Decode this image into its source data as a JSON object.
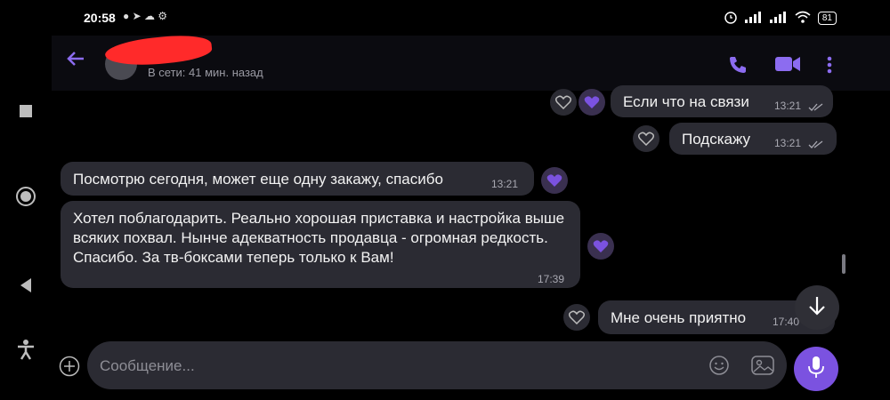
{
  "status": {
    "time": "20:58",
    "battery": "81"
  },
  "header": {
    "contact_name": "",
    "last_seen": "В сети: 41 мин. назад"
  },
  "messages": [
    {
      "text": "Если что на связи",
      "time": "13:21"
    },
    {
      "text": "Подскажу",
      "time": "13:21"
    },
    {
      "text": "Посмотрю сегодня, может еще одну закажу, спасибо",
      "time": "13:21"
    },
    {
      "text": "Хотел поблагодарить. Реально хорошая приставка и настройка выше всяких похвал. Нынче адекватность продавца - огромная редкость. Спасибо. За тв-боксами теперь только к Вам!",
      "time": "17:39"
    },
    {
      "text": "Мне очень приятно",
      "time": "17:40"
    }
  ],
  "composer": {
    "placeholder": "Сообщение..."
  },
  "colors": {
    "accent": "#7b52e0",
    "bubble": "#2b2b33",
    "background": "#000000",
    "redaction": "#ff2a2a"
  },
  "icons": [
    "square-nav-icon",
    "circle-nav-icon",
    "triangle-nav-icon",
    "accessibility-icon",
    "back-arrow-icon",
    "phone-icon",
    "video-call-icon",
    "more-vert-icon",
    "heart-icon",
    "double-check-icon",
    "scroll-down-icon",
    "add-icon",
    "sticker-icon",
    "gallery-icon",
    "mic-icon"
  ]
}
